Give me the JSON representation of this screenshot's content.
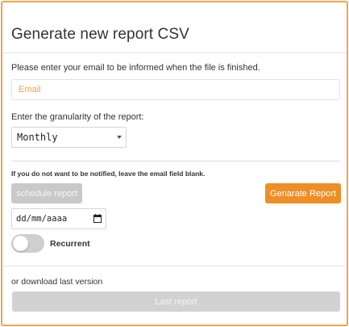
{
  "modal": {
    "title": "Generate new report CSV",
    "email_prompt": "Please enter your email to be informed when the file is finished.",
    "email_placeholder": "Email",
    "email_value": "",
    "granularity_prompt": "Enter the granularity of the report:",
    "granularity_selected": "Monthly",
    "notification_hint": "If you do not want to be notified, leave the email field blank.",
    "schedule_button": "schedule report",
    "generate_button": "Genarate Report",
    "date_placeholder": "dd/mm/aaaa",
    "recurrent_label": "Recurrent",
    "recurrent_on": false,
    "download_prompt": "or download last version",
    "last_report_button": "Last report"
  },
  "colors": {
    "accent": "#ef8e25",
    "border_accent": "#f0a550",
    "disabled_button": "#c9c9c9"
  },
  "icons": {
    "select_caret": "chevron-down-icon",
    "date_picker": "calendar-icon"
  }
}
